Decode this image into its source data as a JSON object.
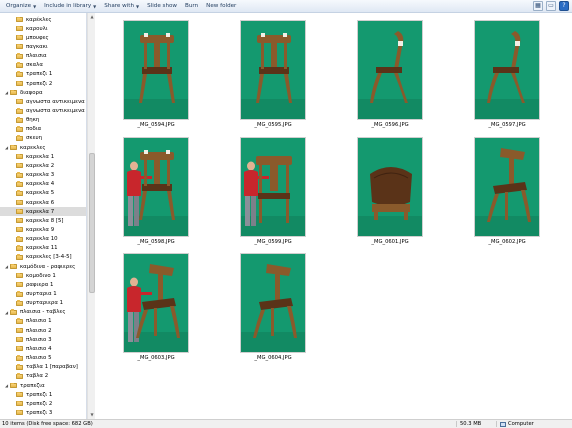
{
  "toolbar": {
    "organize": "Organize",
    "include_in_library": "Include in library",
    "share_with": "Share with",
    "slide_show": "Slide show",
    "burn": "Burn",
    "new_folder": "New folder"
  },
  "nav": {
    "items": [
      {
        "label": "καρέκλες",
        "level": 1,
        "expander": ""
      },
      {
        "label": "καρουλι",
        "level": 1,
        "expander": ""
      },
      {
        "label": "μπουφες",
        "level": 1,
        "expander": ""
      },
      {
        "label": "παγκακι",
        "level": 1,
        "expander": ""
      },
      {
        "label": "πλαισια",
        "level": 1,
        "expander": ""
      },
      {
        "label": "σκαλα",
        "level": 1,
        "expander": ""
      },
      {
        "label": "τραπεζι 1",
        "level": 1,
        "expander": ""
      },
      {
        "label": "τραπεζι 2",
        "level": 1,
        "expander": ""
      },
      {
        "label": "διαφορα",
        "level": 0,
        "expander": "◢"
      },
      {
        "label": "αγνωστα αντικειμενα 1",
        "level": 1,
        "expander": ""
      },
      {
        "label": "αγνωστα αντικειμενα 2",
        "level": 1,
        "expander": ""
      },
      {
        "label": "θηκη",
        "level": 1,
        "expander": ""
      },
      {
        "label": "ποδια",
        "level": 1,
        "expander": ""
      },
      {
        "label": "σκευη",
        "level": 1,
        "expander": ""
      },
      {
        "label": "καρεκλες",
        "level": 0,
        "expander": "◢"
      },
      {
        "label": "καρεκλα 1",
        "level": 1,
        "expander": ""
      },
      {
        "label": "καρεκλα 2",
        "level": 1,
        "expander": ""
      },
      {
        "label": "καρεκλα 3",
        "level": 1,
        "expander": ""
      },
      {
        "label": "καρεκλα 4",
        "level": 1,
        "expander": ""
      },
      {
        "label": "καρεκλα 5",
        "level": 1,
        "expander": ""
      },
      {
        "label": "καρεκλα 6",
        "level": 1,
        "expander": ""
      },
      {
        "label": "καρεκλα 7",
        "level": 1,
        "expander": "",
        "selected": true
      },
      {
        "label": "καρεκλα 8 [5]",
        "level": 1,
        "expander": ""
      },
      {
        "label": "καρεκλα 9",
        "level": 1,
        "expander": ""
      },
      {
        "label": "καρεκλα 10",
        "level": 1,
        "expander": ""
      },
      {
        "label": "καρεκλα 11",
        "level": 1,
        "expander": ""
      },
      {
        "label": "καρεκλες [3-4-5]",
        "level": 1,
        "expander": ""
      },
      {
        "label": "καμόδινα - ραφιερες",
        "level": 0,
        "expander": "◢"
      },
      {
        "label": "κομοδινο 1",
        "level": 1,
        "expander": ""
      },
      {
        "label": "ραφιερα 1",
        "level": 1,
        "expander": ""
      },
      {
        "label": "συρταρια 1",
        "level": 1,
        "expander": ""
      },
      {
        "label": "συρταριερα 1",
        "level": 1,
        "expander": ""
      },
      {
        "label": "πλαισια - ταβλες",
        "level": 0,
        "expander": "◢"
      },
      {
        "label": "πλαισιο 1",
        "level": 1,
        "expander": ""
      },
      {
        "label": "πλαισιο 2",
        "level": 1,
        "expander": ""
      },
      {
        "label": "πλαισιο 3",
        "level": 1,
        "expander": ""
      },
      {
        "label": "πλαισιο 4",
        "level": 1,
        "expander": ""
      },
      {
        "label": "πλαισιο 5",
        "level": 1,
        "expander": ""
      },
      {
        "label": "ταβλα 1 [παραβαν]",
        "level": 1,
        "expander": ""
      },
      {
        "label": "ταβλα 2",
        "level": 1,
        "expander": ""
      },
      {
        "label": "τραπεζια",
        "level": 0,
        "expander": "◢"
      },
      {
        "label": "τραπεζι 1",
        "level": 1,
        "expander": ""
      },
      {
        "label": "τραπεζι 2",
        "level": 1,
        "expander": ""
      },
      {
        "label": "τραπεζι 3",
        "level": 1,
        "expander": ""
      }
    ]
  },
  "files": [
    {
      "name": "_MG_0594.JPG",
      "view": "front",
      "person": false
    },
    {
      "name": "_MG_0595.JPG",
      "view": "front",
      "person": false
    },
    {
      "name": "_MG_0596.JPG",
      "view": "side",
      "person": false
    },
    {
      "name": "_MG_0597.JPG",
      "view": "side",
      "person": false
    },
    {
      "name": "_MG_0598.JPG",
      "view": "front",
      "person": true
    },
    {
      "name": "_MG_0599.JPG",
      "view": "back",
      "person": true
    },
    {
      "name": "_MG_0601.JPG",
      "view": "top",
      "person": false
    },
    {
      "name": "_MG_0602.JPG",
      "view": "angle",
      "person": false
    },
    {
      "name": "_MG_0603.JPG",
      "view": "angle",
      "person": true
    },
    {
      "name": "_MG_0604.JPG",
      "view": "angle",
      "person": false
    }
  ],
  "status": {
    "items": "10 items (Disk free space: 682 GB)",
    "size": "50.3 MB",
    "location": "Computer"
  },
  "colors": {
    "backdrop": "#14996f",
    "wood": "#8a5a2b",
    "leather": "#5a3318",
    "shirt": "#c8262c"
  }
}
